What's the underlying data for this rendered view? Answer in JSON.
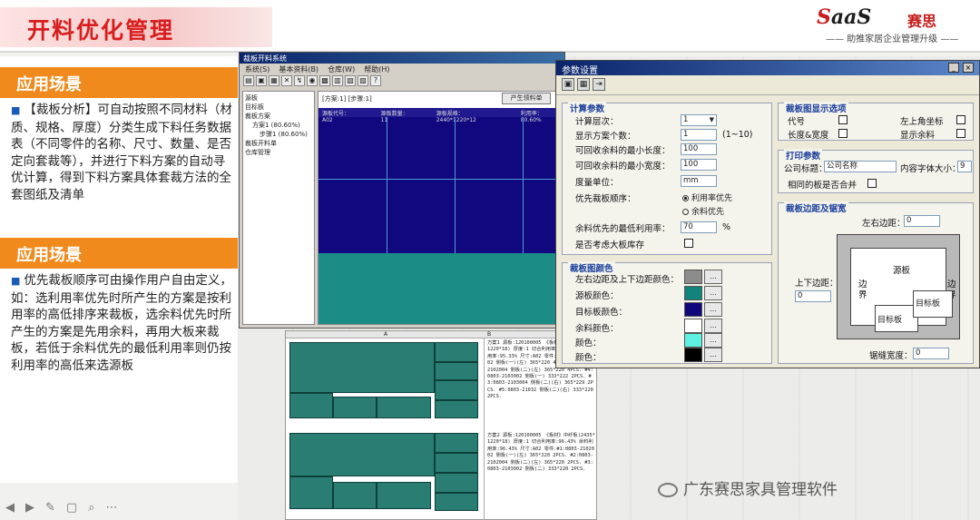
{
  "slide": {
    "title": "开料优化管理",
    "logo_word_s": "S",
    "logo_word_aas": "aaS",
    "logo_cn": "赛思",
    "logo_slogan": "—— 助推家居企业管理升级 ——"
  },
  "scenes": [
    {
      "heading": "应用场景",
      "bullet": "■",
      "text": "【裁板分析】可自动按照不同材料（材质、规格、厚度）分类生成下料任务数据表（不同零件的名称、尺寸、数量、是否定向套裁等），并进行下料方案的自动寻优计算，得到下料方案具体套裁方法的全套图纸及清单"
    },
    {
      "heading": "应用场景",
      "bullet": "■",
      "text": "优先裁板顺序可由操作用户自由定义，如：选利用率优先时所产生的方案是按利用率的高低排序来裁板，选余料优先时所产生的方案是先用余料，再用大板来裁板，若低于余料优先的最低利用率则仍按利用率的高低来选源板"
    }
  ],
  "main_window": {
    "title": "裁板开料系统",
    "menu": [
      "系统(S)",
      "基本资料(B)",
      "仓库(W)",
      "帮助(H)"
    ],
    "tree": [
      "源板",
      "目标板",
      "裁板方案",
      "方案1 (80.60%)",
      "步骤1 (80.60%)",
      "裁板开料单",
      "仓库管理"
    ],
    "scheme_label": "[方案:1] [步骤:1]",
    "generate_button": "产生领料单",
    "board_info": [
      "源板代号：A02",
      "源板数量：11",
      "源板规格：2440*1220*12",
      "利用率：80.60%"
    ]
  },
  "param_dialog": {
    "title": "参数设置",
    "close_glyph": "×",
    "min_glyph": "_",
    "calc": {
      "title": "计算参数",
      "level_label": "计算层次：",
      "level_value": "1",
      "scheme_count_label": "显示方案个数：",
      "scheme_count_value": "1",
      "scheme_count_range": "(1~10)",
      "min_length_label": "可回收余料的最小长度：",
      "min_length_value": "100",
      "min_width_label": "可回收余料的最小宽度：",
      "min_width_value": "100",
      "unit_label": "度量单位：",
      "unit_value": "mm",
      "order_label": "优先裁板顺序：",
      "order_opt1": "利用率优先",
      "order_opt2": "余料优先",
      "remnant_rate_label": "余料优先的最低利用率：",
      "remnant_rate_value": "70",
      "percent": "%",
      "big_board_label": "是否考虑大板库存"
    },
    "colors": {
      "title": "裁板图颜色",
      "rows": [
        {
          "label": "左右边距及上下边距颜色：",
          "color": "#8c8c8c"
        },
        {
          "label": "源板颜色：",
          "color": "#12837c"
        },
        {
          "label": "目标板颜色：",
          "color": "#10087a"
        },
        {
          "label": "余料颜色：",
          "color": "#ffffff"
        },
        {
          "label": "颜色：",
          "color": "#5ef0e0"
        },
        {
          "label": "颜色：",
          "color": "#000000"
        }
      ],
      "dots": "…"
    },
    "display": {
      "title": "裁板图显示选项",
      "code": "代号",
      "len_width": "长度&宽度",
      "coord": "左上角坐标",
      "show_remnant": "显示余料"
    },
    "print": {
      "title": "打印参数",
      "company_label": "公司标题：",
      "company_value": "公司名称",
      "font_label": "内容字体大小：",
      "font_value": "9",
      "merge_label": "相同的板是否合并"
    },
    "margins": {
      "title": "裁板边距及锯宽",
      "lr_label": "左右边距：",
      "lr_value": "0",
      "tb_label": "上下边距：",
      "tb_value": "0",
      "saw_label": "锯缝宽度：",
      "saw_value": "0",
      "src": "源板",
      "edge_l": "边界",
      "edge_r": "边界",
      "target1": "目标板",
      "target2": "目标板"
    }
  },
  "sheet": {
    "col_a": "A",
    "col_b": "B",
    "note1": "方案1  源板:120100005 《板材》中纤板(2435*1220*18) 厚度:1 切合利用率:95.33% 余料利用率:95.33% 尺寸:A02 零件:#1:0803-2102002 侧板(一)(左) 365*220 4PCS. #2:0803-2102004 侧板(二)(左) 365*220 4PCS. #4:0803-2103002 侧板(一) 333*222 2PCS. #3:0803-2103004 侧板(二)(右) 365*229 2PCS. #5:0803-21032 侧板(二)(右) 333*220 2PCS.",
    "note2": "方案2  源板:120100005 《板材》中纤板(2435*1220*18) 厚度:1 切合利用率:96.43% 余料利用率:96.43% 尺寸:A02 零件:#1:0803-2102002 侧板(一)(左) 365*220 2PCS. #2:0803-2102004 侧板(二)(左) 365*220 2PCS. #3:0803-2103002 侧板(二) 333*220 2PCS."
  },
  "watermark": "广东赛思家具管理软件",
  "presenter_tools": [
    "◀",
    "▶",
    "✎",
    "▢",
    "⌕",
    "⋯"
  ]
}
